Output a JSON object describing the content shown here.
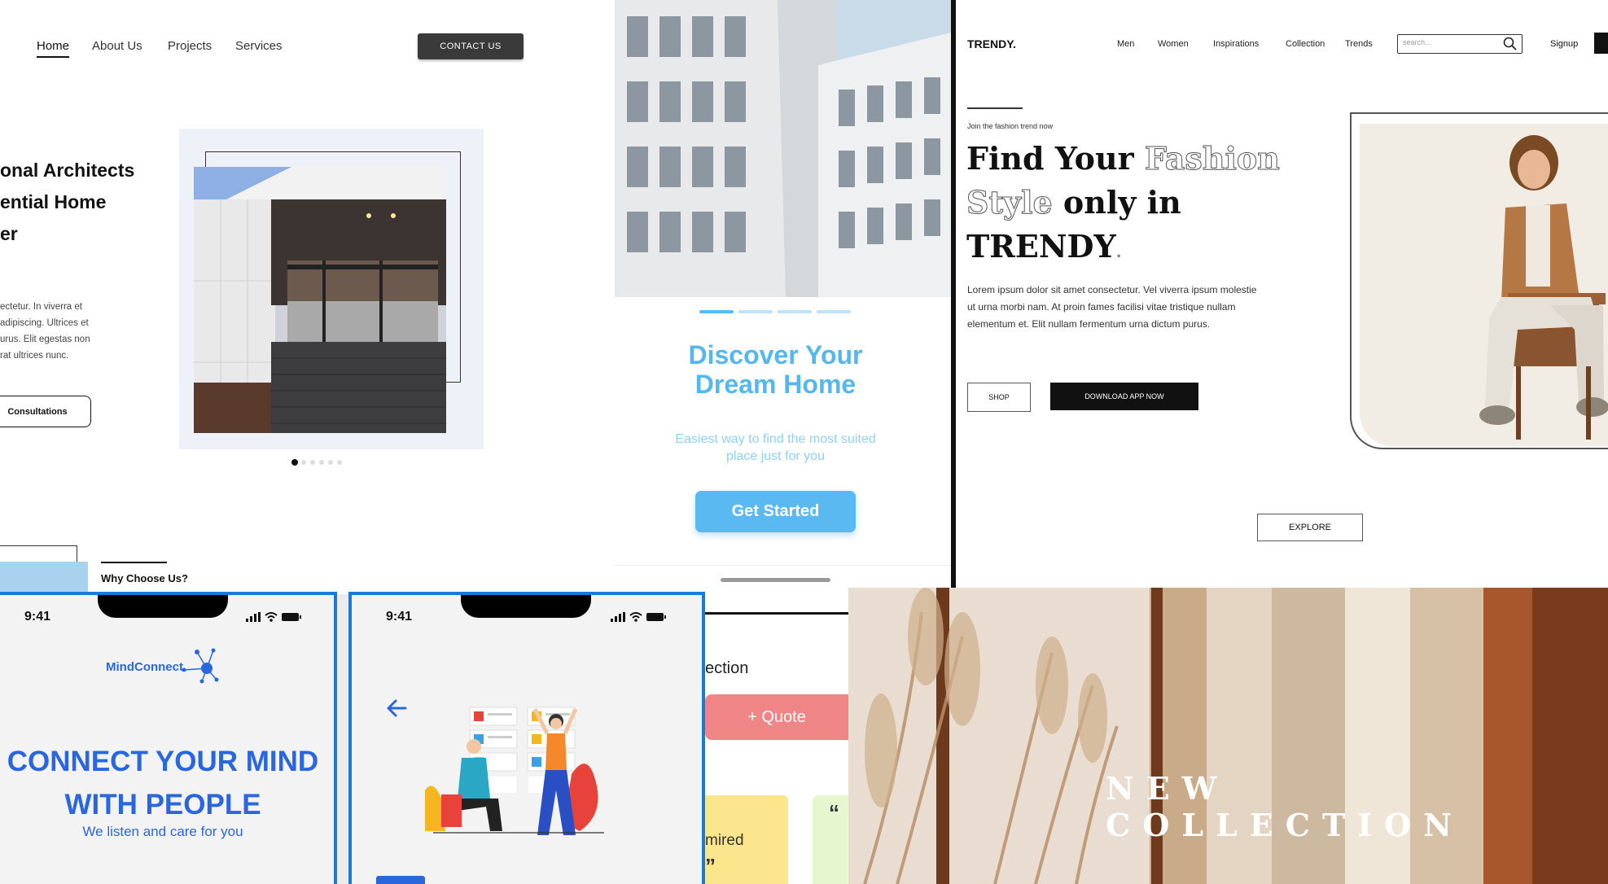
{
  "arch": {
    "nav": [
      "Home",
      "About Us",
      "Projects",
      "Services"
    ],
    "contact_label": "CONTACT US",
    "hero_title": "onal Architects\nential Home\ner",
    "hero_body": "ectetur. In viverra et\nadipiscing. Ultrices et\nurus. Elit egestas non\nrat ultrices nunc.",
    "cta_label": "Consultations",
    "why_label": "Why Choose Us?"
  },
  "dream": {
    "title": "Discover Your\nDream Home",
    "subtitle": "Easiest way to find the most suited\nplace just for you",
    "button_label": "Get Started"
  },
  "trendy": {
    "brand": "TRENDY.",
    "nav": [
      "Men",
      "Women",
      "Inspirations",
      "Collection",
      "Trends"
    ],
    "search_placeholder": "search...",
    "signup_label": "Signup",
    "kicker": "Join the fashion trend now",
    "hero_find": "Find Your",
    "hero_fashion": "Fashion",
    "hero_style": "Style",
    "hero_only_in": "only  in",
    "hero_brand": "TRENDY",
    "hero_body": "Lorem ipsum dolor sit amet consectetur. Vel viverra ipsum molestie ut urna morbi nam. At proin fames facilisi vitae tristique nullam elementum et. Elit nullam fermentum urna dictum purus.",
    "shop_label": "SHOP",
    "download_label": "DOWNLOAD APP NOW",
    "explore_label": "EXPLORE"
  },
  "mind1": {
    "time": "9:41",
    "brand": "MindConnect",
    "title": "CONNECT YOUR MIND\nWITH PEOPLE",
    "subtitle": "We listen and care for you"
  },
  "mind2": {
    "time": "9:41"
  },
  "collection_panel": {
    "heading": "ection",
    "quote_label": "+ Quote",
    "note_text": "mired",
    "quote_mark": "”",
    "quote_mark2": "“"
  },
  "new_collection": {
    "title": "NEW COLLECTION"
  },
  "colors": {
    "dream_blue": "#56b6ee",
    "mind_blue": "#2a66de",
    "phone_frame": "#1a7bd6",
    "quote_pink": "#f08585"
  }
}
